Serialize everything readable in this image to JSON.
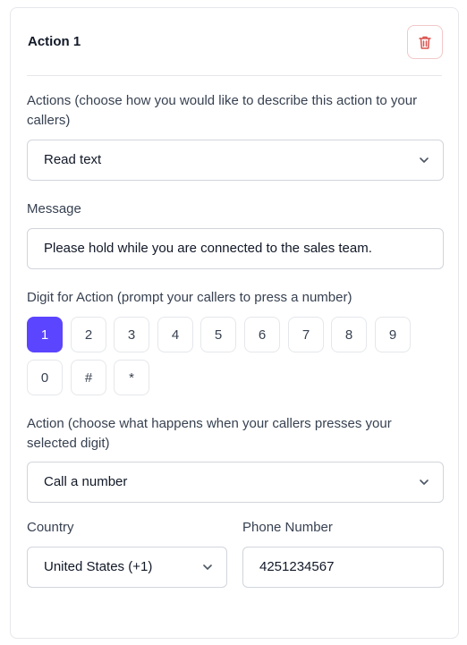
{
  "card": {
    "title": "Action 1"
  },
  "actions_field": {
    "label": "Actions (choose how you would like to describe this action to your callers)",
    "value": "Read text"
  },
  "message_field": {
    "label": "Message",
    "value": "Please hold while you are connected to the sales team."
  },
  "digit_field": {
    "label": "Digit for Action (prompt your callers to press a number)",
    "digits": [
      "1",
      "2",
      "3",
      "4",
      "5",
      "6",
      "7",
      "8",
      "9",
      "0",
      "#",
      "*"
    ],
    "selected": "1"
  },
  "action_field": {
    "label": "Action (choose what happens when your callers presses your selected digit)",
    "value": "Call a number"
  },
  "country_field": {
    "label": "Country",
    "value": "United States (+1)"
  },
  "phone_field": {
    "label": "Phone Number",
    "value": "4251234567"
  },
  "colors": {
    "accent": "#5b45ff",
    "delete_icon": "#d9534f",
    "border": "#d1d5db"
  },
  "icons": {
    "delete": "trash-icon",
    "dropdown": "chevron-down-icon"
  }
}
